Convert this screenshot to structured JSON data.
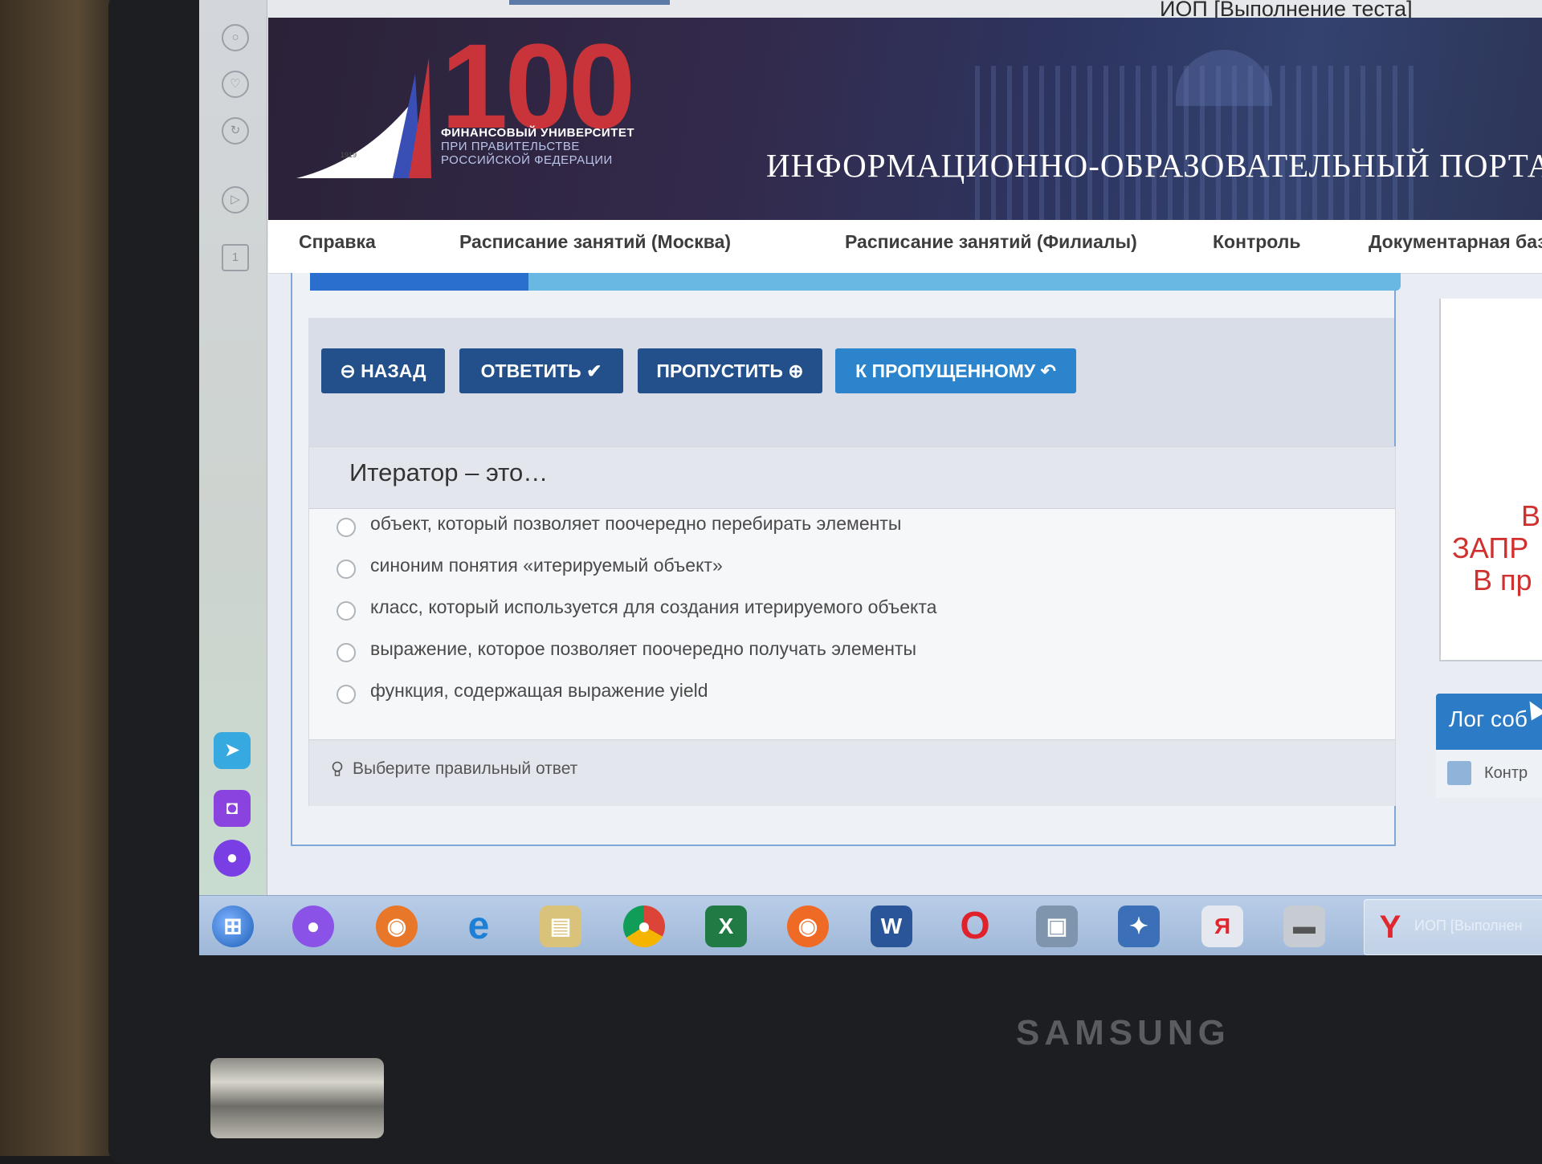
{
  "browser": {
    "title": "ИОП [Выполнение теста]"
  },
  "banner": {
    "logo_number": "100",
    "logo_year": "1919",
    "logo_lines": [
      "ФИНАНСОВЫЙ УНИВЕРСИТЕТ",
      "ПРИ ПРАВИТЕЛЬСТВЕ",
      "РОССИЙСКОЙ ФЕДЕРАЦИИ"
    ],
    "portal_title": "ИНФОРМАЦИОННО-ОБРАЗОВАТЕЛЬНЫЙ ПОРТАЛ"
  },
  "nav": {
    "items": [
      "Справка",
      "Расписание занятий (Москва)",
      "Расписание занятий (Филиалы)",
      "Контроль",
      "Документарная база"
    ]
  },
  "progress": {
    "fraction": 0.2
  },
  "toolbar": {
    "back": "НАЗАД",
    "answer": "ОТВЕТИТЬ",
    "skip": "ПРОПУСТИТЬ",
    "to_skipped": "К ПРОПУЩЕННОМУ"
  },
  "question": {
    "title": "Итератор – это…",
    "options": [
      "объект, который позволяет поочередно перебирать элементы",
      "синоним понятия «итерируемый объект»",
      "класс, который используется для создания итерируемого объекта",
      "выражение, которое позволяет поочередно получать элементы",
      "функция, содержащая выражение yield"
    ],
    "hint": "Выберите правильный ответ"
  },
  "right_panel": {
    "lines": [
      "В",
      "ЗАПР",
      "В пр"
    ],
    "log_title": "Лог соб",
    "log_item": "Контр"
  },
  "taskbar": {
    "active_window": "ИОП [Выполнен",
    "icons": [
      "start-orb",
      "alice",
      "firefox",
      "internet-explorer",
      "file-manager",
      "chrome",
      "excel",
      "firefox-alt",
      "word",
      "opera",
      "network",
      "cleanup",
      "yandex",
      "device",
      "yandex-browser"
    ]
  },
  "device": {
    "brand": "SAMSUNG"
  },
  "colors": {
    "button_dark": "#23508a",
    "button_light": "#2b84cc",
    "progress_fill": "#2a6fcd",
    "progress_track": "#69b7e3",
    "logo_red": "#c8343a",
    "warning_red": "#d0302e"
  }
}
